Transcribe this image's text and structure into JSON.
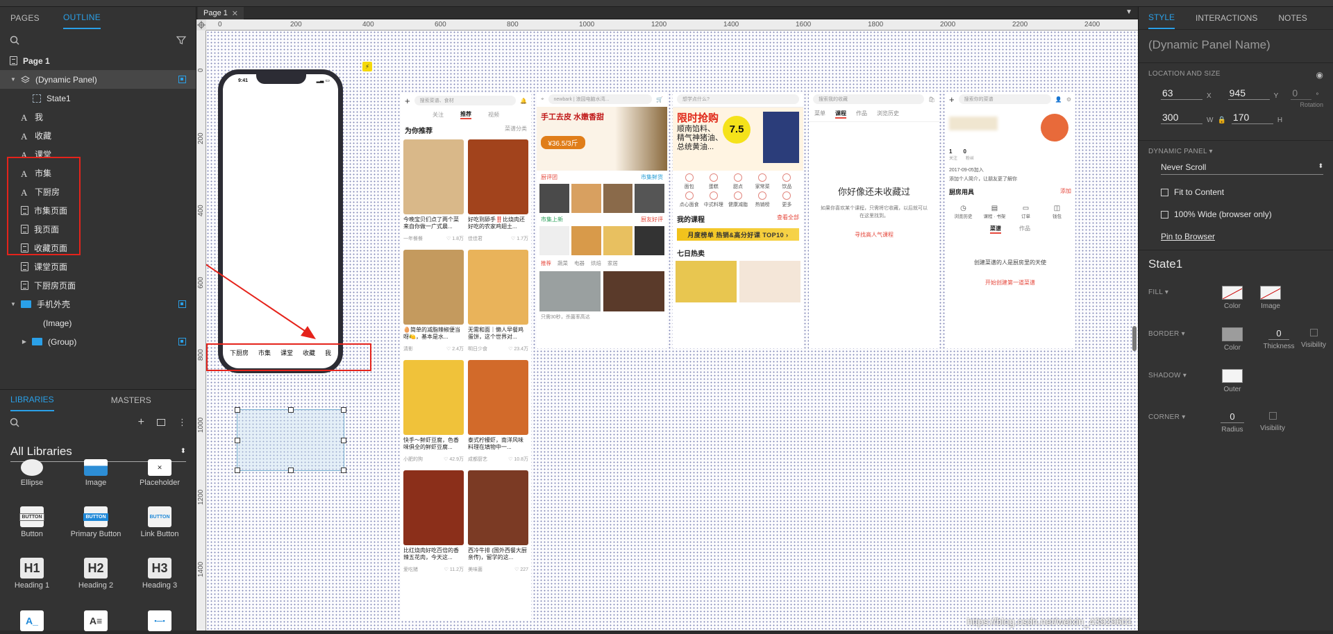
{
  "left_panel": {
    "tabs": [
      "PAGES",
      "OUTLINE"
    ],
    "outline": [
      {
        "label": "Page 1",
        "icon": "page-icon"
      },
      {
        "label": "(Dynamic Panel)",
        "icon": "layers-icon"
      },
      {
        "label": "State1",
        "icon": "state-icon"
      },
      {
        "label": "我",
        "icon": "text-icon"
      },
      {
        "label": "收藏",
        "icon": "text-icon"
      },
      {
        "label": "课堂",
        "icon": "text-icon"
      },
      {
        "label": "市集",
        "icon": "text-icon"
      },
      {
        "label": "下厨房",
        "icon": "text-icon"
      },
      {
        "label": "市集页面",
        "icon": "page-icon"
      },
      {
        "label": "我页面",
        "icon": "page-icon"
      },
      {
        "label": "收藏页面",
        "icon": "page-icon"
      },
      {
        "label": "课堂页面",
        "icon": "page-icon"
      },
      {
        "label": "下厨房页面",
        "icon": "page-icon"
      },
      {
        "label": "手机外壳",
        "icon": "folder-icon"
      },
      {
        "label": "(Image)",
        "icon": "image-icon"
      },
      {
        "label": "(Group)",
        "icon": "folder-icon"
      }
    ],
    "lib_tabs": [
      "LIBRARIES",
      "MASTERS"
    ],
    "library_select": "All Libraries",
    "widgets": [
      "Ellipse",
      "Image",
      "Placeholder",
      "Button",
      "Primary Button",
      "Link Button",
      "Heading 1",
      "Heading 2",
      "Heading 3"
    ],
    "widget_thumbs": [
      "BUTTON",
      "BUTTON",
      "BUTTON",
      "H1",
      "H2",
      "H3"
    ]
  },
  "canvas": {
    "tab": "Page 1",
    "ruler_h": [
      "0",
      "200",
      "400",
      "600",
      "800",
      "1000",
      "1200",
      "1400",
      "1600",
      "1800",
      "2000",
      "2200",
      "2400"
    ],
    "ruler_v": [
      "0",
      "200",
      "400",
      "600",
      "800",
      "1000",
      "1200",
      "1400"
    ],
    "phone": {
      "time": "9:41",
      "tabbar": [
        "下厨房",
        "市集",
        "课堂",
        "收藏",
        "我"
      ]
    },
    "screen1": {
      "search": "搜索菜谱、食材",
      "tabs": [
        "关注",
        "推荐",
        "视频"
      ],
      "heading": "为你推荐",
      "heading_right": "菜谱分类",
      "cards": [
        {
          "caption": "今晚宝贝们点了两个菜来自你做一广式晨...",
          "author": "一年餐餐",
          "likes": "1.8万"
        },
        {
          "caption": "好吃到舔手‼️比烧肉还好吃的农家鸡翅土...",
          "author": "佳佳君",
          "likes": "1.7万"
        },
        {
          "caption": "🥚简单的减脂辣椒便当呀🍋，基本是水...",
          "author": "清影",
          "likes": "2.4万"
        },
        {
          "caption": "无需和面｜懒人早餐鸡蛋饼，这个世界对...",
          "author": "明日少食",
          "likes": "23.4万"
        },
        {
          "caption": "快手～鲜虾豆腐，色香味俱全的鲜虾豆腐...",
          "author": "小肥的狗",
          "likes": "42.9万"
        },
        {
          "caption": "泰式柠檬虾，南洋风味料理在填物中一...",
          "author": "成都厨艺",
          "likes": "10.8万"
        },
        {
          "caption": "比红烧肉好吃百倍的香辣五花肉，今天这...",
          "author": "爱吃猪",
          "likes": "11.2万"
        },
        {
          "caption": "西冷牛排 (国外西餐大厨亲传)，留学的这...",
          "author": "美味菌",
          "likes": "227"
        }
      ]
    },
    "screen2": {
      "search": "newbark | 浪园电脑水湾...",
      "banner_title": "手工去皮 水嫩香甜",
      "banner_price": "¥36.5/3斤",
      "sections": [
        "厨评团",
        "市集鲜货",
        "市集上新",
        "厨友好评"
      ],
      "tabs": [
        "推荐",
        "蔬菜",
        "电器",
        "烘焙",
        "家居"
      ],
      "bottom": "只需30秒，杀菌率高达"
    },
    "screen3": {
      "search": "想学点什么?",
      "promo": "限时抢购",
      "promo_lines": [
        "顺南馅料、",
        "精气神猪油、",
        "总统黄油..."
      ],
      "promo_badge": "7.5",
      "icons": [
        "面包",
        "蛋糕",
        "甜点",
        "家常菜",
        "饮品",
        "点心面食",
        "中式料理",
        "健康减脂",
        "热销榜",
        "更多"
      ],
      "course_title": "我的课程",
      "course_link": "查看全部",
      "banner": "月度榜单 热销&高分好课 TOP10 ›",
      "hot": "七日热卖"
    },
    "screen4": {
      "search": "搜索我的收藏",
      "tabs": [
        "菜单",
        "课程",
        "作品",
        "浏览历史"
      ],
      "empty_title": "你好像还未收藏过",
      "empty_desc": "如果你喜欢某个课程，只需将它收藏，以后就可以在这里找到。",
      "link": "寻找高人气课程"
    },
    "screen5": {
      "search": "搜索你的菜谱",
      "stats": [
        "1",
        "0"
      ],
      "stat_labels": [
        "关注",
        "粉丝"
      ],
      "joined": "2017-09-05加入",
      "bio": "添加个人简介，让朋友更了解你",
      "section": "厨房用具",
      "section_link": "添加",
      "tools": [
        "浏览历史",
        "课程 · 书架",
        "订单",
        "钱包"
      ],
      "tabs": [
        "菜谱",
        "作品"
      ],
      "empty": "创建菜谱的人是厨房里的天使",
      "cta": "开始创建第一道菜谱"
    },
    "watermark": "https://blog.csdn.net/weixin_43929601"
  },
  "right_panel": {
    "tabs": [
      "STYLE",
      "INTERACTIONS",
      "NOTES"
    ],
    "name_placeholder": "(Dynamic Panel Name)",
    "location_label": "LOCATION AND SIZE",
    "x": "63",
    "y": "945",
    "rotation": "0",
    "w": "300",
    "h": "170",
    "x_label": "X",
    "y_label": "Y",
    "w_label": "W",
    "h_label": "H",
    "rotation_label": "Rotation",
    "degree": "°",
    "dp_label": "DYNAMIC PANEL ▾",
    "scroll": "Never Scroll",
    "fit": "Fit to Content",
    "wide": "100% Wide (browser only)",
    "pin": "Pin to Browser",
    "state": "State1",
    "fill": "FILL ▾",
    "fill_color": "Color",
    "fill_image": "Image",
    "border": "BORDER ▾",
    "border_color": "Color",
    "thickness": "0",
    "thickness_label": "Thickness",
    "visibility": "Visibility",
    "shadow": "SHADOW ▾",
    "outer": "Outer",
    "corner": "CORNER ▾",
    "radius": "0",
    "radius_label": "Radius",
    "corner_visibility": "Visibility"
  }
}
